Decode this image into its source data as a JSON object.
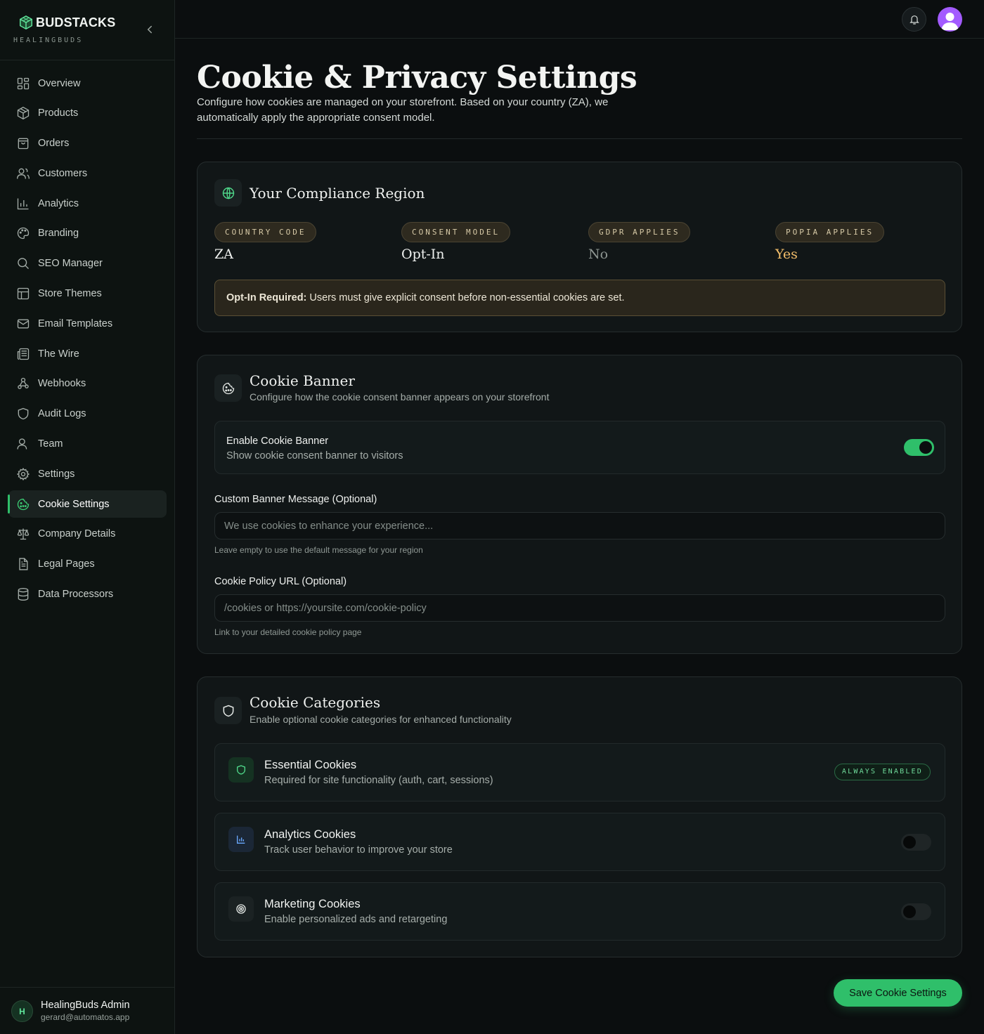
{
  "brand": {
    "name": "BUDSTACKS",
    "sub": "HEALINGBUDS"
  },
  "sidebar": {
    "items": [
      {
        "label": "Overview",
        "icon": "grid-icon"
      },
      {
        "label": "Products",
        "icon": "box-icon"
      },
      {
        "label": "Orders",
        "icon": "shopping-bag-icon"
      },
      {
        "label": "Customers",
        "icon": "users-icon"
      },
      {
        "label": "Analytics",
        "icon": "bar-chart-icon"
      },
      {
        "label": "Branding",
        "icon": "palette-icon"
      },
      {
        "label": "SEO Manager",
        "icon": "search-icon"
      },
      {
        "label": "Store Themes",
        "icon": "layout-icon"
      },
      {
        "label": "Email Templates",
        "icon": "mail-icon"
      },
      {
        "label": "The Wire",
        "icon": "newspaper-icon"
      },
      {
        "label": "Webhooks",
        "icon": "webhook-icon"
      },
      {
        "label": "Audit Logs",
        "icon": "shield-icon"
      },
      {
        "label": "Team",
        "icon": "user-icon"
      },
      {
        "label": "Settings",
        "icon": "gear-icon"
      },
      {
        "label": "Cookie Settings",
        "icon": "cookie-icon",
        "active": true
      },
      {
        "label": "Company Details",
        "icon": "scale-icon"
      },
      {
        "label": "Legal Pages",
        "icon": "file-text-icon"
      },
      {
        "label": "Data Processors",
        "icon": "database-icon"
      }
    ]
  },
  "user": {
    "initial": "H",
    "name": "HealingBuds Admin",
    "email": "gerard@automatos.app"
  },
  "page": {
    "title": "Cookie & Privacy Settings",
    "description": "Configure how cookies are managed on your storefront. Based on your country (ZA), we automatically apply the appropriate consent model."
  },
  "region": {
    "title": "Your Compliance Region",
    "country_label": "COUNTRY CODE",
    "country_value": "ZA",
    "consent_label": "CONSENT MODEL",
    "consent_value": "Opt-In",
    "gdpr_label": "GDPR APPLIES",
    "gdpr_value": "No",
    "popia_label": "POPIA APPLIES",
    "popia_value": "Yes",
    "notice_bold": "Opt-In Required:",
    "notice_text": "Users must give explicit consent before non-essential cookies are set."
  },
  "banner": {
    "title": "Cookie Banner",
    "subtitle": "Configure how the cookie consent banner appears on your storefront",
    "enable_title": "Enable Cookie Banner",
    "enable_sub": "Show cookie consent banner to visitors",
    "enabled": true,
    "message_label": "Custom Banner Message (Optional)",
    "message_placeholder": "We use cookies to enhance your experience...",
    "message_hint": "Leave empty to use the default message for your region",
    "url_label": "Cookie Policy URL (Optional)",
    "url_placeholder": "/cookies or https://yoursite.com/cookie-policy",
    "url_hint": "Link to your detailed cookie policy page"
  },
  "categories": {
    "title": "Cookie Categories",
    "subtitle": "Enable optional cookie categories for enhanced functionality",
    "items": [
      {
        "title": "Essential Cookies",
        "sub": "Required for site functionality (auth, cart, sessions)",
        "badge": "ALWAYS ENABLED",
        "icon": "shield-icon"
      },
      {
        "title": "Analytics Cookies",
        "sub": "Track user behavior to improve your store",
        "enabled": false,
        "icon": "bar-chart-icon"
      },
      {
        "title": "Marketing Cookies",
        "sub": "Enable personalized ads and retargeting",
        "enabled": false,
        "icon": "target-icon"
      }
    ]
  },
  "save_label": "Save Cookie Settings",
  "colors": {
    "accent": "#2fbf6a",
    "gold": "#f2bd6a",
    "background": "#0b0e0f"
  }
}
